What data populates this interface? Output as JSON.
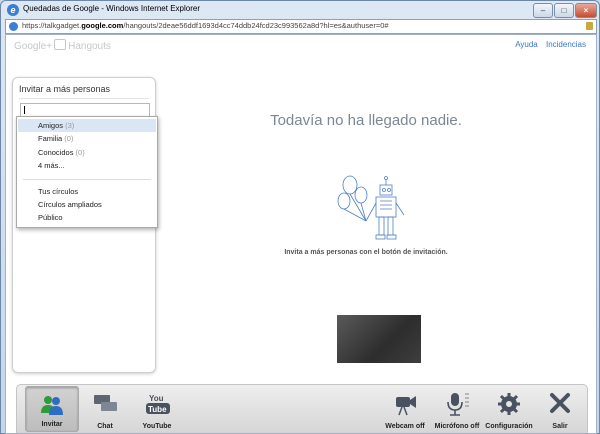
{
  "window": {
    "title": "Quedadas de Google - Windows Internet Explorer",
    "ie_icon": "ie-logo-icon",
    "controls": [
      "minimize",
      "maximize",
      "close"
    ]
  },
  "address_bar": {
    "url_prefix": "https://talkgadget.",
    "url_domain": "google.com",
    "url_rest": "/hangouts/2deae56ddf1693d4cc74ddb24fcd23c993562a8d?hl=es&authuser=0#"
  },
  "header": {
    "logo_text_1": "Google+",
    "logo_text_2": "Hangouts",
    "help_link": "Ayuda",
    "issues_link": "Incidencias"
  },
  "invite_panel": {
    "title": "Invitar a más personas",
    "input_value": ""
  },
  "dropdown": {
    "items": [
      {
        "label": "Amigos",
        "count": "(3)",
        "selected": true
      },
      {
        "label": "Familia",
        "count": "(0)"
      },
      {
        "label": "Conocidos",
        "count": "(0)"
      },
      {
        "label": "4 más...",
        "count": ""
      },
      {
        "label": "Tus círculos",
        "count": ""
      },
      {
        "label": "Círculos ampliados",
        "count": ""
      },
      {
        "label": "Público",
        "count": ""
      }
    ]
  },
  "main": {
    "empty_message": "Todavía no ha llegado nadie.",
    "hint": "Invita a más personas con el botón de invitación."
  },
  "toolbar": {
    "invite": "Invitar",
    "chat": "Chat",
    "youtube": "YouTube",
    "youtube_logo_1": "You",
    "youtube_logo_2": "Tube",
    "webcam": "Webcam off",
    "mic": "Micrófono off",
    "settings": "Configuración",
    "exit": "Salir"
  },
  "colors": {
    "link": "#3a75c4",
    "empty_text": "#7b8796",
    "toolbar_icon": "#4a5160",
    "invite_icon_green": "#2f9a3a",
    "invite_icon_blue": "#2f6dc2"
  }
}
